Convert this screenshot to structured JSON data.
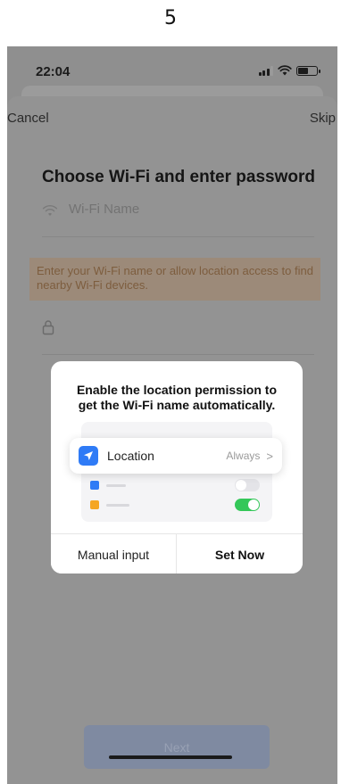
{
  "page_number": "5",
  "status_bar": {
    "time": "22:04"
  },
  "nav": {
    "cancel": "Cancel",
    "skip": "Skip"
  },
  "title": "Choose Wi-Fi and enter password",
  "wifi_field": {
    "placeholder": "Wi-Fi Name"
  },
  "warning_text": "Enter your Wi-Fi name or allow location access to find nearby Wi-Fi devices.",
  "dialog": {
    "title": "Enable the location permission to get the Wi-Fi name automatically.",
    "location_row": {
      "label": "Location",
      "value": "Always",
      "chevron": ">"
    },
    "manual_button": "Manual input",
    "setnow_button": "Set Now"
  },
  "next_button": "Next",
  "colors": {
    "accent_blue": "#2f7bf6",
    "toggle_green": "#34c759",
    "warning_text": "#7d5d3e"
  }
}
